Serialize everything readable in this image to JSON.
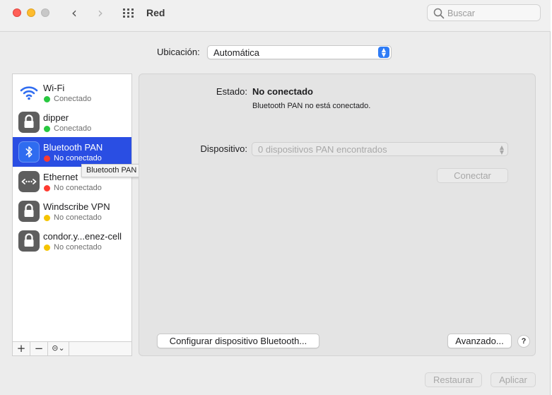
{
  "window": {
    "title": "Red",
    "search_placeholder": "Buscar"
  },
  "location": {
    "label": "Ubicación:",
    "value": "Automática"
  },
  "services": [
    {
      "name": "Wi-Fi",
      "status": "Conectado",
      "status_color": "#28c840",
      "icon": "wifi-icon"
    },
    {
      "name": "dipper",
      "status": "Conectado",
      "status_color": "#28c840",
      "icon": "lock-icon"
    },
    {
      "name": "Bluetooth PAN",
      "status": "No conectado",
      "status_color": "#ff3b30",
      "icon": "bluetooth-icon",
      "selected": true
    },
    {
      "name": "Ethernet",
      "status": "No conectado",
      "status_color": "#ff3b30",
      "icon": "ethernet-icon"
    },
    {
      "name": "Windscribe VPN",
      "status": "No conectado",
      "status_color": "#f5c400",
      "icon": "lock-icon"
    },
    {
      "name": "condor.y...enez-cell",
      "status": "No conectado",
      "status_color": "#f5c400",
      "icon": "lock-icon"
    }
  ],
  "tooltip": "Bluetooth PAN",
  "sidebar_toolbar": {
    "add": "+",
    "remove": "−",
    "action": "⊝⌄"
  },
  "detail": {
    "status_label": "Estado:",
    "status_value": "No conectado",
    "status_description": "Bluetooth PAN no está conectado.",
    "device_label": "Dispositivo:",
    "device_value": "0 dispositivos PAN encontrados",
    "connect_button": "Conectar",
    "configure_button": "Configurar dispositivo Bluetooth...",
    "advanced_button": "Avanzado...",
    "help_button": "?"
  },
  "footer": {
    "revert_button": "Restaurar",
    "apply_button": "Aplicar"
  },
  "colors": {
    "accent": "#2a4ee3",
    "connected": "#28c840",
    "disconnected": "#ff3b30",
    "inactive": "#f5c400"
  }
}
